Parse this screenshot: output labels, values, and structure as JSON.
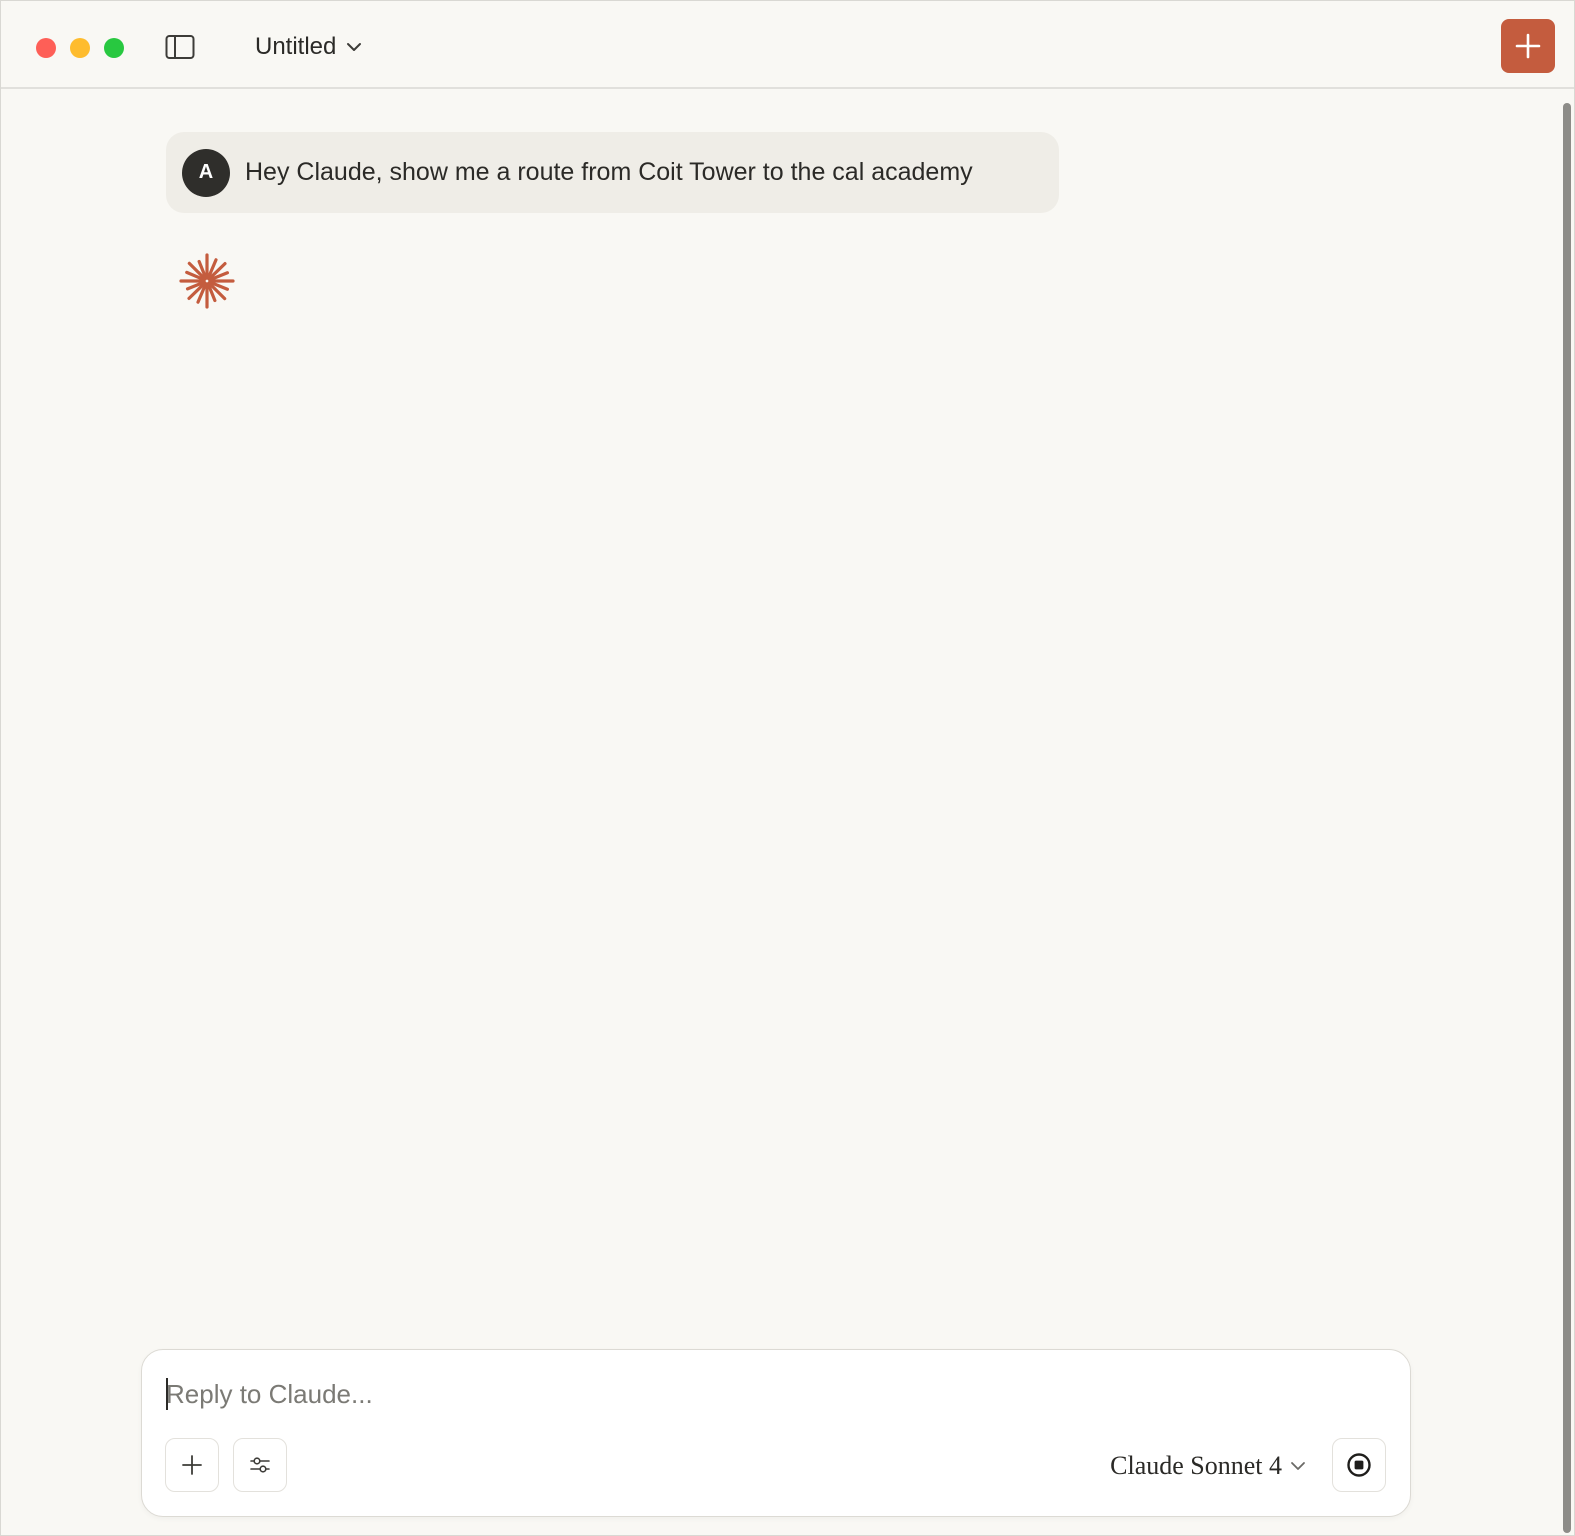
{
  "window": {
    "title": "Untitled"
  },
  "icons": {
    "sidebar_toggle": "sidebar-icon",
    "title_dropdown": "chevron-down-icon",
    "new_chat": "plus-icon",
    "attach": "plus-icon",
    "settings": "sliders-icon",
    "model_dropdown": "chevron-down-icon",
    "stop": "stop-icon",
    "claude": "claude-spark-icon"
  },
  "conversation": {
    "user_message": {
      "avatar_initial": "A",
      "text": "Hey Claude, show me a route from Coit Tower to the cal academy"
    }
  },
  "composer": {
    "placeholder": "Reply to Claude...",
    "value": "",
    "model": "Claude Sonnet 4"
  },
  "colors": {
    "accent": "#c45c3e",
    "background": "#f9f8f4",
    "user_bubble": "#efede7",
    "avatar": "#2f2e2b"
  }
}
